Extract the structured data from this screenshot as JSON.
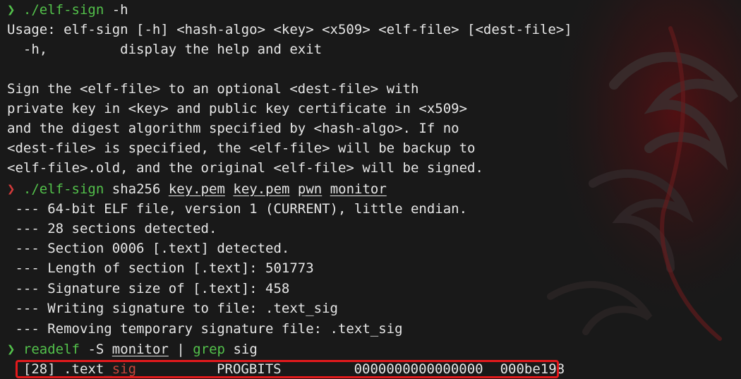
{
  "terminal": {
    "prompt_symbol": "❯",
    "cmd1": {
      "program": "./elf-sign",
      "args": " -h"
    },
    "usage_lines": [
      "Usage: elf-sign [-h] <hash-algo> <key> <x509> <elf-file> [<dest-file>]",
      "  -h,         display the help and exit",
      "",
      "Sign the <elf-file> to an optional <dest-file> with",
      "private key in <key> and public key certificate in <x509>",
      "and the digest algorithm specified by <hash-algo>. If no",
      "<dest-file> is specified, the <elf-file> will be backup to",
      "<elf-file>.old, and the original <elf-file> will be signed."
    ],
    "cmd2": {
      "program": "./elf-sign",
      "hash": "sha256",
      "args": [
        "key.pem",
        "key.pem",
        "pwn",
        "monitor"
      ]
    },
    "output_lines": [
      " --- 64-bit ELF file, version 1 (CURRENT), little endian.",
      " --- 28 sections detected.",
      " --- Section 0006 [.text] detected.",
      " --- Length of section [.text]: 501773",
      " --- Signature size of [.text]: 458",
      " --- Writing signature to file: .text_sig",
      " --- Removing temporary signature file: .text_sig"
    ],
    "cmd3": {
      "program": "readelf",
      "flag": "-S",
      "file": "monitor",
      "pipe": "|",
      "grep": "grep",
      "pattern": "sig"
    },
    "result_row": {
      "index": "  [28]",
      "name_prefix": ".text_",
      "name_match": "sig",
      "type": "PROGBITS",
      "address": "0000000000000000",
      "offset": "000be198"
    }
  },
  "colors": {
    "background": "#191919",
    "text": "#e6e6e6",
    "prompt_ok": "#53c14b",
    "prompt_error": "#d23a3a",
    "match_highlight": "#c8463c",
    "annotation_box": "#e2191c"
  }
}
